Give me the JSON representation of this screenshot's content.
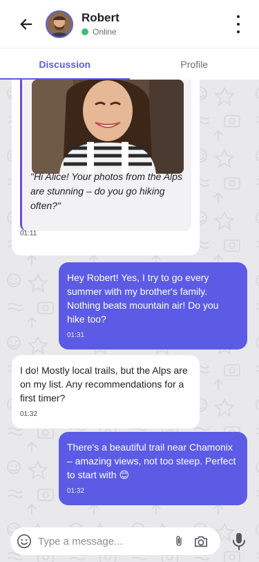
{
  "contact": {
    "name": "Robert",
    "status": "Online"
  },
  "tabs": [
    {
      "label": "Discussion",
      "active": true
    },
    {
      "label": "Profile",
      "active": false
    }
  ],
  "messages": [
    {
      "direction": "incoming",
      "quote": "\"Hi Alice! Your photos from the Alps are stunning – do you go hiking often?\"",
      "time": "01:11"
    },
    {
      "direction": "outgoing",
      "text": "Hey Robert! Yes, I try to go every summer with my brother's family. Nothing beats mountain air! Do you hike too?",
      "time": "01:31"
    },
    {
      "direction": "incoming",
      "text": "I do! Mostly local trails, but the Alps are on my list. Any recommendations for a first timer?",
      "time": "01:32"
    },
    {
      "direction": "outgoing",
      "text": "There's a beautiful trail near Chamonix – amazing views, not too steep. Perfect to start with 😊",
      "time": "01:32"
    }
  ],
  "composer": {
    "placeholder": "Type a message..."
  },
  "colors": {
    "accent": "#5b5be6",
    "online": "#3fbf72",
    "outgoing_bubble": "#5b5be6",
    "incoming_bubble": "#ffffff",
    "chat_background": "#e9e9ec"
  },
  "icons": [
    "arrow-left-icon",
    "more-vertical-icon",
    "emoji-icon",
    "paperclip-icon",
    "camera-icon",
    "microphone-icon"
  ]
}
